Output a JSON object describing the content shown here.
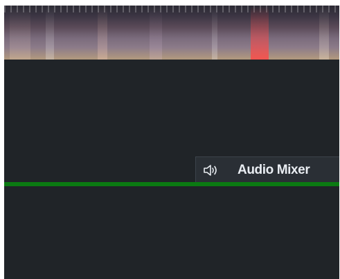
{
  "video_preview": {
    "colors": {
      "panel_bg": "#202428",
      "accent_line": "#0b7a12",
      "tab_bg": "#2a2f35",
      "tab_text": "#e9edf2"
    }
  },
  "audio_mixer": {
    "label": "Audio Mixer",
    "icon": "speaker-icon"
  }
}
